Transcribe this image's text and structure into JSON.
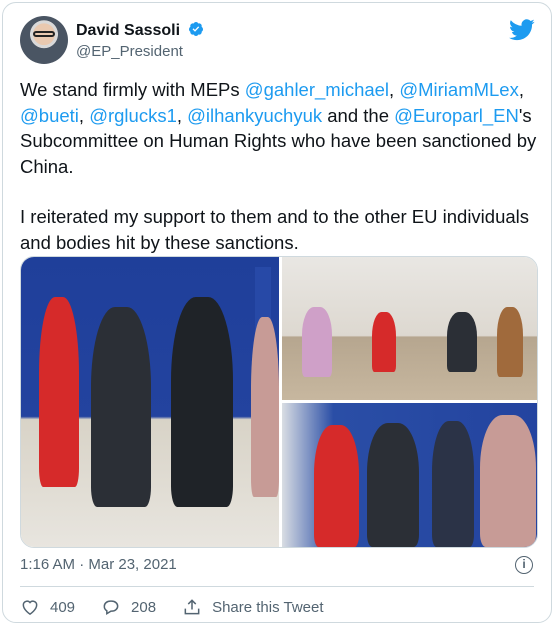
{
  "author": {
    "name": "David Sassoli",
    "handle": "@EP_President"
  },
  "tweet": {
    "paragraph1": {
      "text_start": "We stand firmly with MEPs ",
      "mention1": "@gahler_michael",
      "sep1": ",",
      "mention2": "@MiriamMLex",
      "sep2": ", ",
      "mention3": "@bueti",
      "sep3": ", ",
      "mention4": "@rglucks1",
      "sep4": ", ",
      "mention5": "@ilhankyuchyuk",
      "text_mid": " and the ",
      "mention6": "@Europarl_EN",
      "text_end": "'s Subcommittee on Human Rights who have been sanctioned by China."
    },
    "paragraph2": "I reiterated my support to them and to the other EU individuals and bodies hit by these sanctions."
  },
  "meta": {
    "timestamp": "1:16 AM · Mar 23, 2021"
  },
  "actions": {
    "likes": "409",
    "replies": "208",
    "share_label": "Share this Tweet"
  },
  "colors": {
    "accent": "#1d9bf0",
    "text": "#0f1419",
    "muted": "#536471"
  },
  "icons": [
    "verified-badge-icon",
    "twitter-bird-icon",
    "info-icon",
    "heart-icon",
    "reply-icon",
    "share-icon"
  ]
}
